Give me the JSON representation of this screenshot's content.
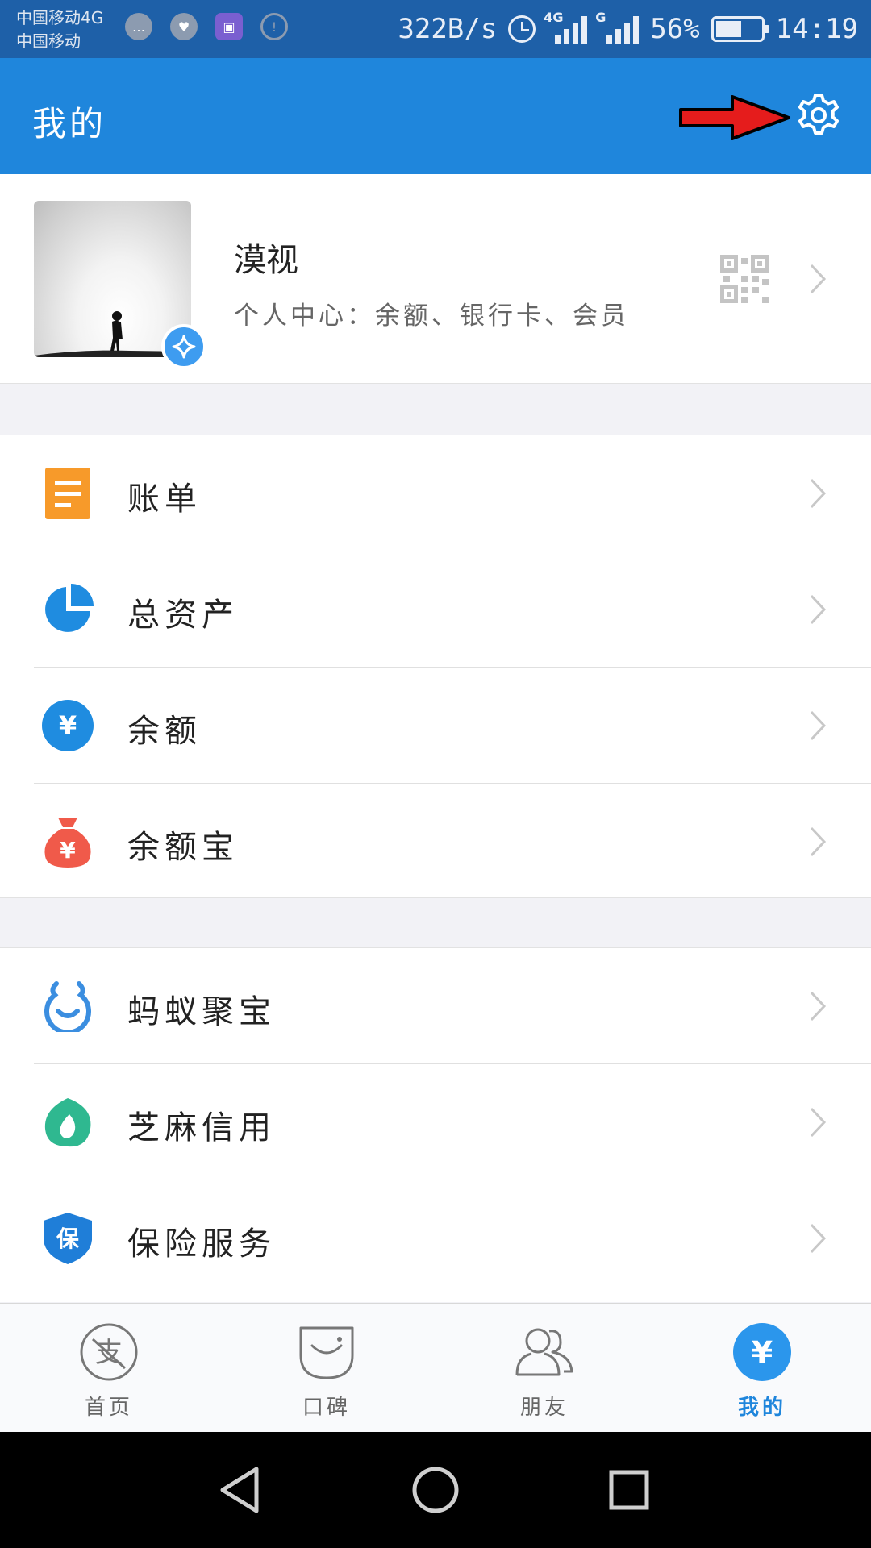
{
  "status_bar": {
    "carrier1": "中国移动4G",
    "carrier2": "中国移动",
    "net_speed": "322B/s",
    "signal1_tag": "4G",
    "signal2_tag": "G",
    "battery": "56%",
    "battery_level": 0.56,
    "time": "14:19"
  },
  "header": {
    "title": "我的",
    "settings_icon": "gear-icon",
    "annotation_icon": "red-arrow-icon"
  },
  "profile": {
    "name": "漠视",
    "subtitle": "个人中心：余额、银行卡、会员",
    "qr_icon": "qr-code-icon"
  },
  "menu_group1": [
    {
      "label": "账单",
      "icon": "bill-icon",
      "color": "#f79a2a"
    },
    {
      "label": "总资产",
      "icon": "pie-chart-icon",
      "color": "#1f8ce0"
    },
    {
      "label": "余额",
      "icon": "yuan-coin-icon",
      "color": "#1f8ce0"
    },
    {
      "label": "余额宝",
      "icon": "money-bag-icon",
      "color": "#f05a4a"
    }
  ],
  "menu_group2": [
    {
      "label": "蚂蚁聚宝",
      "icon": "ant-fortune-icon",
      "color": "#3b8ee0"
    },
    {
      "label": "芝麻信用",
      "icon": "sesame-credit-icon",
      "color": "#2fb890"
    },
    {
      "label": "保险服务",
      "icon": "insurance-shield-icon",
      "color": "#1f7ed8"
    }
  ],
  "tabs": [
    {
      "label": "首页",
      "icon": "alipay-home-icon"
    },
    {
      "label": "口碑",
      "icon": "koubei-icon"
    },
    {
      "label": "朋友",
      "icon": "friends-icon"
    },
    {
      "label": "我的",
      "icon": "yuan-me-icon",
      "active": true
    }
  ],
  "colors": {
    "brand": "#1f86dc",
    "status_bar": "#1e60a8",
    "active_tab": "#1f86dc"
  }
}
